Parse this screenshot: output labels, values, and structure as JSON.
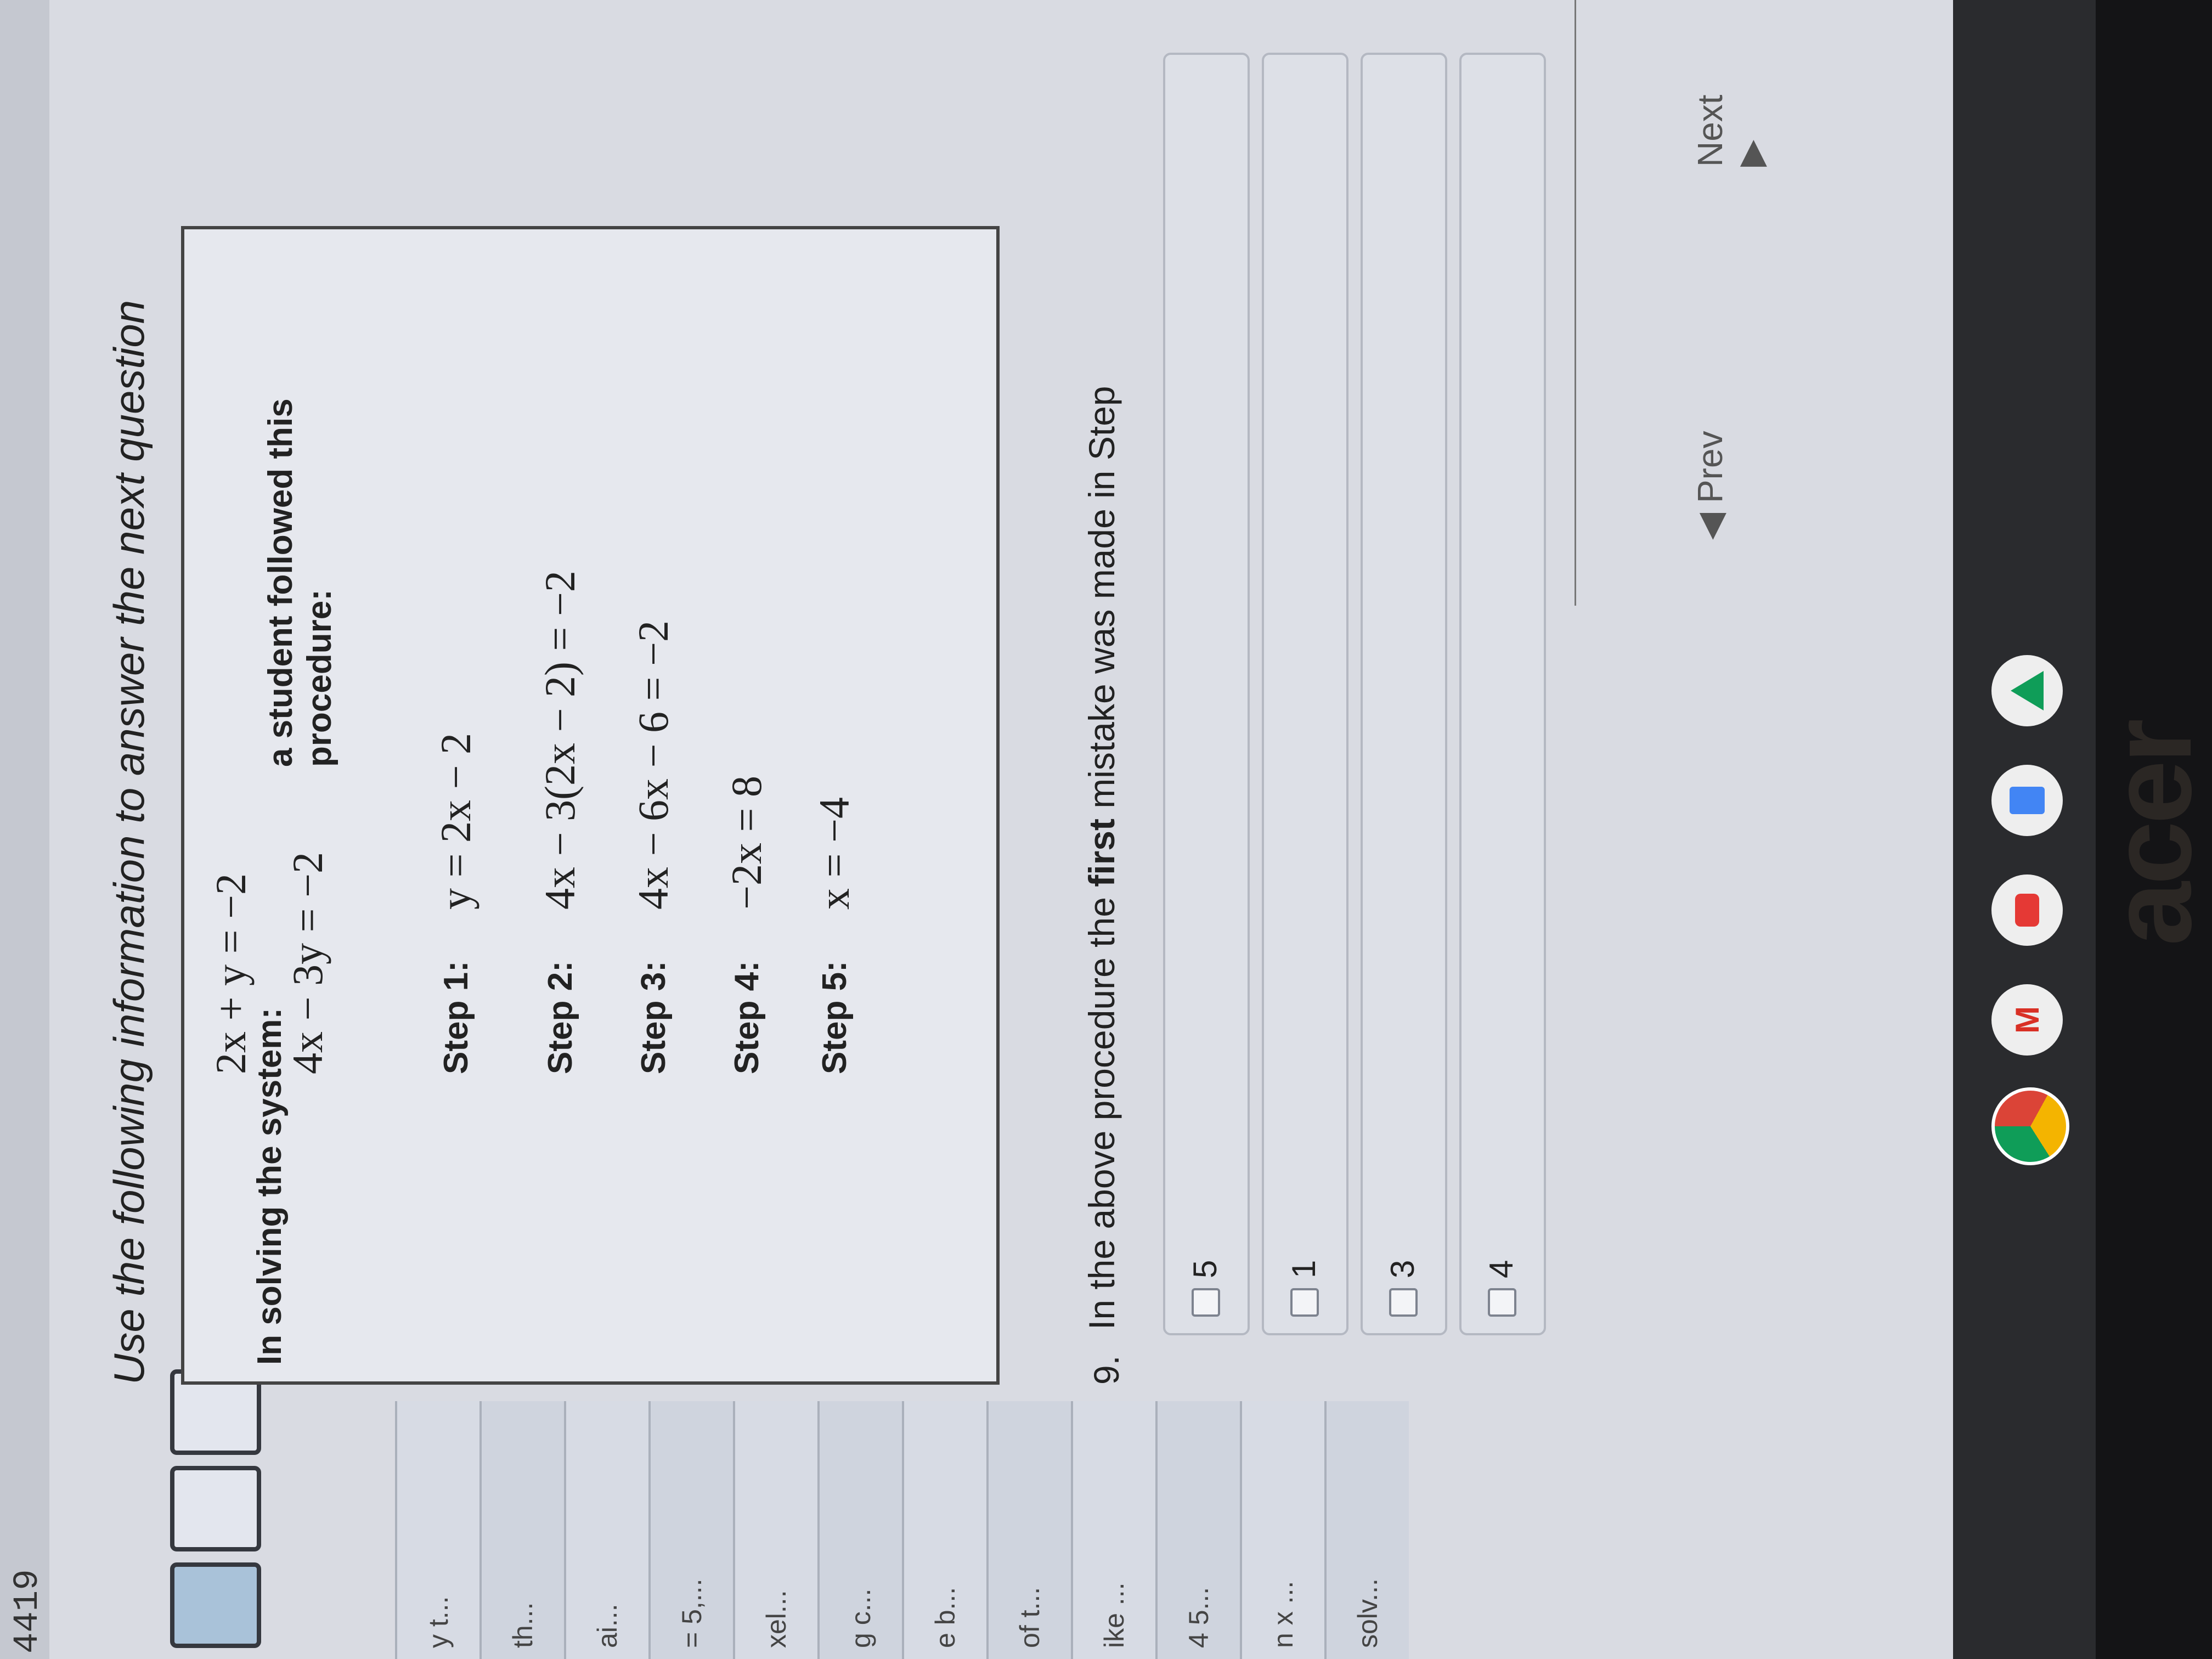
{
  "window": {
    "id_fragment": "4419"
  },
  "sidebar": {
    "tiles": [
      "",
      "",
      ""
    ],
    "items": [
      {
        "label": "y t..."
      },
      {
        "label": "th..."
      },
      {
        "label": "ai..."
      },
      {
        "label": "= 5,..."
      },
      {
        "label": "xel..."
      },
      {
        "label": "g c..."
      },
      {
        "label": "e b..."
      },
      {
        "label": "of t..."
      },
      {
        "label": "ike ..."
      },
      {
        "label": "4 5..."
      },
      {
        "label": "n x ..."
      },
      {
        "label": "solv..."
      }
    ]
  },
  "instruction": "Use the following information to answer the next question",
  "info": {
    "system_label": "In solving the system:",
    "eq1": "2x + y = −2",
    "eq2": "4x − 3y = −2",
    "procedure_label": "a student followed this procedure:",
    "steps": [
      {
        "label": "Step 1:",
        "equation": "y = 2x − 2"
      },
      {
        "label": "Step 2:",
        "equation": "4x − 3(2x − 2) = −2"
      },
      {
        "label": "Step 3:",
        "equation": "4x − 6x − 6 = −2"
      },
      {
        "label": "Step 4:",
        "equation": "−2x = 8"
      },
      {
        "label": "Step 5:",
        "equation": "x = −4"
      }
    ]
  },
  "question": {
    "number": "9.",
    "text_before": "In the above procedure the ",
    "emphasis": "first",
    "text_after": " mistake was made in Step",
    "choices": [
      "5",
      "1",
      "3",
      "4"
    ]
  },
  "navigation": {
    "prev": "◀ Prev",
    "next": "Next ▶"
  },
  "shelf": {
    "apps": [
      {
        "name": "chrome",
        "color": "#db4437"
      },
      {
        "name": "gmail",
        "color": "#e8e8e8"
      },
      {
        "name": "youtube",
        "color": "#e53935"
      },
      {
        "name": "docs",
        "color": "#4285f4"
      },
      {
        "name": "drive",
        "color": "#f4f4f4"
      }
    ]
  },
  "brand": "acer"
}
